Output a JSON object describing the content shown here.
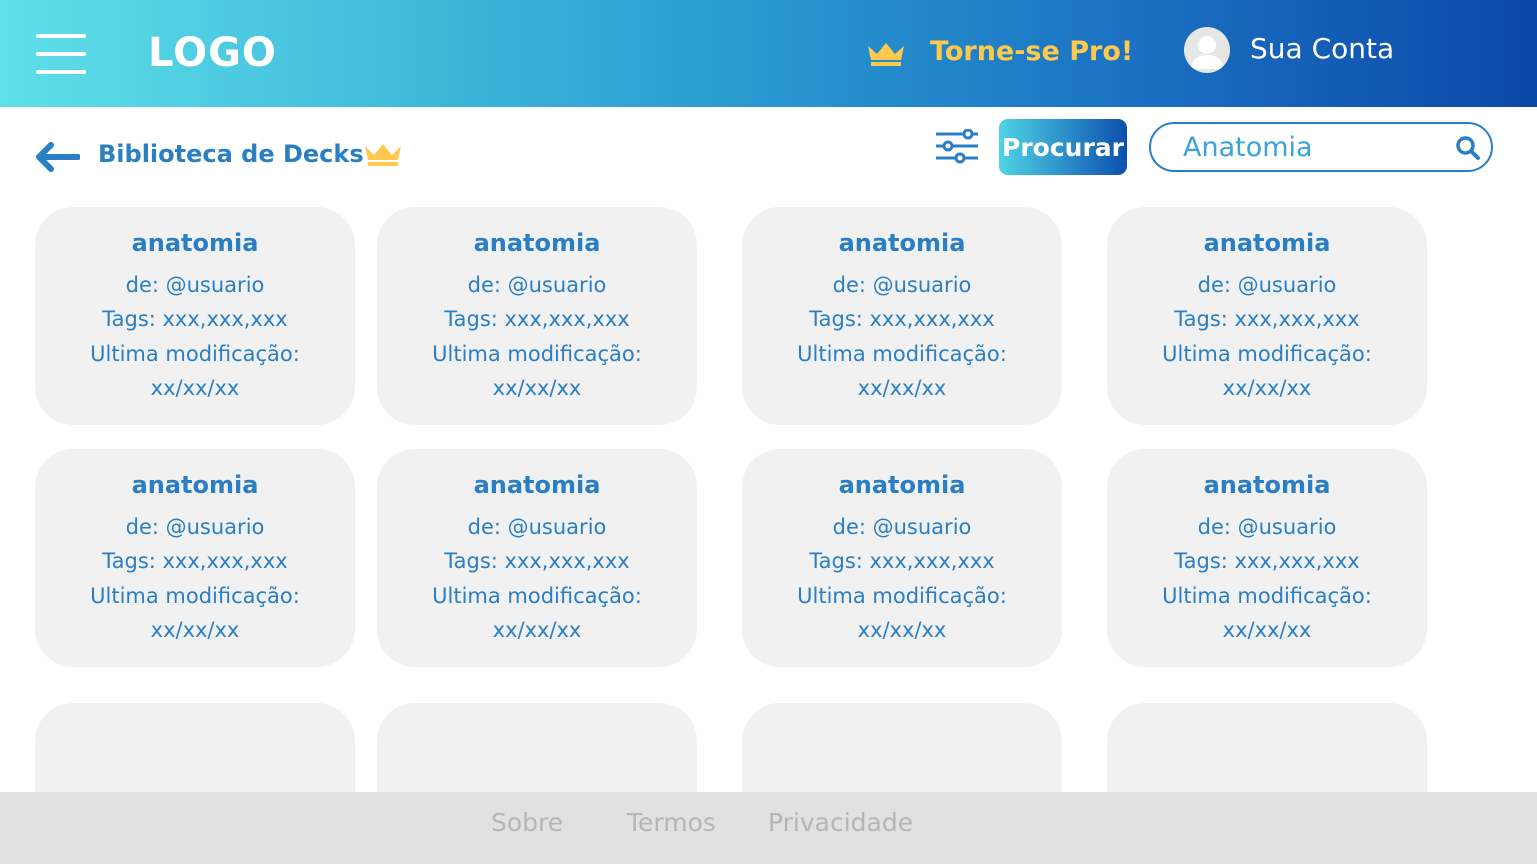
{
  "header": {
    "logo": "LOGO",
    "pro_label": "Torne-se Pro!",
    "account_label": "Sua Conta"
  },
  "toolbar": {
    "page_title": "Biblioteca de Decks",
    "search_button": "Procurar",
    "search_value": "Anatomia"
  },
  "decks": [
    {
      "title": "anatomia",
      "author": "de: @usuario",
      "tags": "Tags: xxx,xxx,xxx",
      "modified_label": "Ultima modificação:",
      "modified_date": "xx/xx/xx"
    },
    {
      "title": "anatomia",
      "author": "de: @usuario",
      "tags": "Tags: xxx,xxx,xxx",
      "modified_label": "Ultima modificação:",
      "modified_date": "xx/xx/xx"
    },
    {
      "title": "anatomia",
      "author": "de: @usuario",
      "tags": "Tags: xxx,xxx,xxx",
      "modified_label": "Ultima modificação:",
      "modified_date": "xx/xx/xx"
    },
    {
      "title": "anatomia",
      "author": "de: @usuario",
      "tags": "Tags: xxx,xxx,xxx",
      "modified_label": "Ultima modificação:",
      "modified_date": "xx/xx/xx"
    },
    {
      "title": "anatomia",
      "author": "de: @usuario",
      "tags": "Tags: xxx,xxx,xxx",
      "modified_label": "Ultima modificação:",
      "modified_date": "xx/xx/xx"
    },
    {
      "title": "anatomia",
      "author": "de: @usuario",
      "tags": "Tags: xxx,xxx,xxx",
      "modified_label": "Ultima modificação:",
      "modified_date": "xx/xx/xx"
    },
    {
      "title": "anatomia",
      "author": "de: @usuario",
      "tags": "Tags: xxx,xxx,xxx",
      "modified_label": "Ultima modificação:",
      "modified_date": "xx/xx/xx"
    },
    {
      "title": "anatomia",
      "author": "de: @usuario",
      "tags": "Tags: xxx,xxx,xxx",
      "modified_label": "Ultima modificação:",
      "modified_date": "xx/xx/xx"
    }
  ],
  "footer": {
    "links": [
      "Sobre",
      "Termos",
      "Privacidade"
    ]
  },
  "icons": {
    "menu": "hamburger-menu-icon",
    "crown": "crown-icon",
    "avatar": "user-avatar-icon",
    "back": "arrow-left-icon",
    "filter": "sliders-filter-icon",
    "search": "search-icon"
  },
  "colors": {
    "accent_blue": "#2a7fc4",
    "pro_gold": "#ffc94d",
    "header_gradient_start": "#5ee0e8",
    "header_gradient_end": "#0a48a8",
    "card_bg": "#f1f1f1",
    "footer_bg": "#e1e1e1"
  }
}
